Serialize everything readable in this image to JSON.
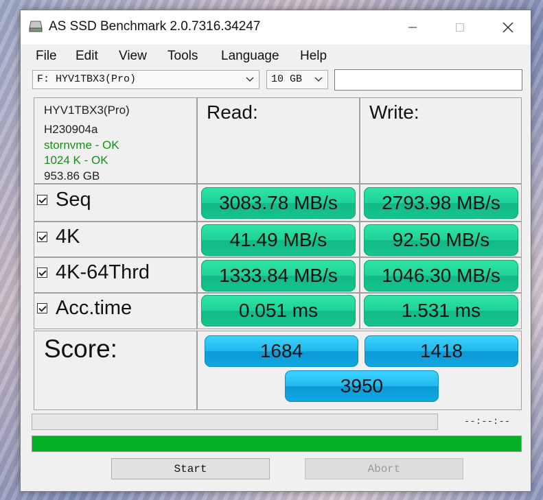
{
  "window": {
    "title": "AS SSD Benchmark 2.0.7316.34247"
  },
  "icons": {
    "app": "disk-drive-icon",
    "minimize": "minimize-icon",
    "maximize": "maximize-icon",
    "close": "close-icon"
  },
  "menu": [
    "File",
    "Edit",
    "View",
    "Tools",
    "Language",
    "Help"
  ],
  "toolbar": {
    "drive_select": "F: HYV1TBX3(Pro)",
    "size_select": "10 GB",
    "text_field": ""
  },
  "drive_info": {
    "model": "HYV1TBX3(Pro)",
    "firmware": "H230904a",
    "driver": "stornvme - OK",
    "alignment": "1024 K - OK",
    "capacity": "953.86 GB"
  },
  "columns": {
    "read": "Read:",
    "write": "Write:"
  },
  "tests": [
    {
      "label": "Seq",
      "checked": true,
      "read": "3083.78 MB/s",
      "write": "2793.98 MB/s"
    },
    {
      "label": "4K",
      "checked": true,
      "read": "41.49 MB/s",
      "write": "92.50 MB/s"
    },
    {
      "label": "4K-64Thrd",
      "checked": true,
      "read": "1333.84 MB/s",
      "write": "1046.30 MB/s"
    },
    {
      "label": "Acc.time",
      "checked": true,
      "read": "0.051 ms",
      "write": "1.531 ms"
    }
  ],
  "score": {
    "label": "Score:",
    "read": "1684",
    "write": "1418",
    "total": "3950"
  },
  "status": {
    "time": "--:--:--",
    "progress": 1.0
  },
  "buttons": {
    "start": "Start",
    "abort": "Abort"
  },
  "colors": {
    "result_green": "#1fd19a",
    "score_blue": "#20b8ee",
    "progress_green": "#06b025",
    "ok_text": "#1c8a1c"
  }
}
